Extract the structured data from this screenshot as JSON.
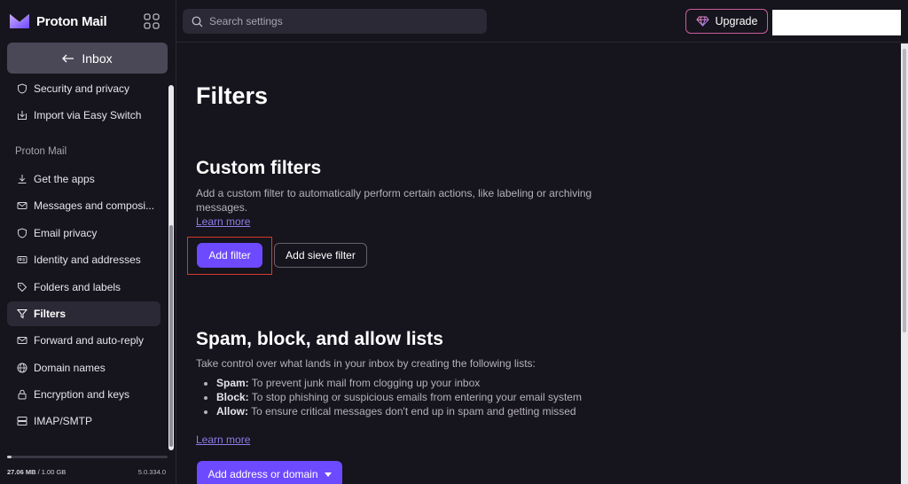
{
  "brand": {
    "name": "Proton Mail"
  },
  "sidebar": {
    "back_label": "Inbox",
    "items_top": [
      {
        "label": "Security and privacy",
        "icon": "shield-icon"
      },
      {
        "label": "Import via Easy Switch",
        "icon": "import-icon"
      }
    ],
    "section_label": "Proton Mail",
    "items": [
      {
        "label": "Get the apps",
        "icon": "download-icon"
      },
      {
        "label": "Messages and composi...",
        "icon": "envelope-icon"
      },
      {
        "label": "Email privacy",
        "icon": "shield-icon"
      },
      {
        "label": "Identity and addresses",
        "icon": "id-card-icon"
      },
      {
        "label": "Folders and labels",
        "icon": "tag-icon"
      },
      {
        "label": "Filters",
        "icon": "filter-icon",
        "active": true
      },
      {
        "label": "Forward and auto-reply",
        "icon": "forward-icon"
      },
      {
        "label": "Domain names",
        "icon": "globe-icon"
      },
      {
        "label": "Encryption and keys",
        "icon": "lock-icon"
      },
      {
        "label": "IMAP/SMTP",
        "icon": "server-icon"
      }
    ],
    "storage": {
      "used": "27.06 MB",
      "total": "/ 1.00 GB",
      "fraction": 0.027
    },
    "version": "5.0.334.0"
  },
  "topbar": {
    "search_placeholder": "Search settings",
    "upgrade_label": "Upgrade"
  },
  "main": {
    "title": "Filters",
    "custom": {
      "heading": "Custom filters",
      "description": "Add a custom filter to automatically perform certain actions, like labeling or archiving messages.",
      "learn_more": "Learn more",
      "add_filter": "Add filter",
      "add_sieve": "Add sieve filter"
    },
    "spam": {
      "heading": "Spam, block, and allow lists",
      "description": "Take control over what lands in your inbox by creating the following lists:",
      "bullets": [
        {
          "term": "Spam:",
          "text": " To prevent junk mail from clogging up your inbox"
        },
        {
          "term": "Block:",
          "text": " To stop phishing or suspicious emails from entering your email system"
        },
        {
          "term": "Allow:",
          "text": " To ensure critical messages don't end up in spam and getting missed"
        }
      ],
      "learn_more": "Learn more",
      "add_address": "Add address or domain"
    }
  },
  "colors": {
    "accent": "#6d4aff",
    "background": "#16141c",
    "highlight": "#d7382f"
  }
}
